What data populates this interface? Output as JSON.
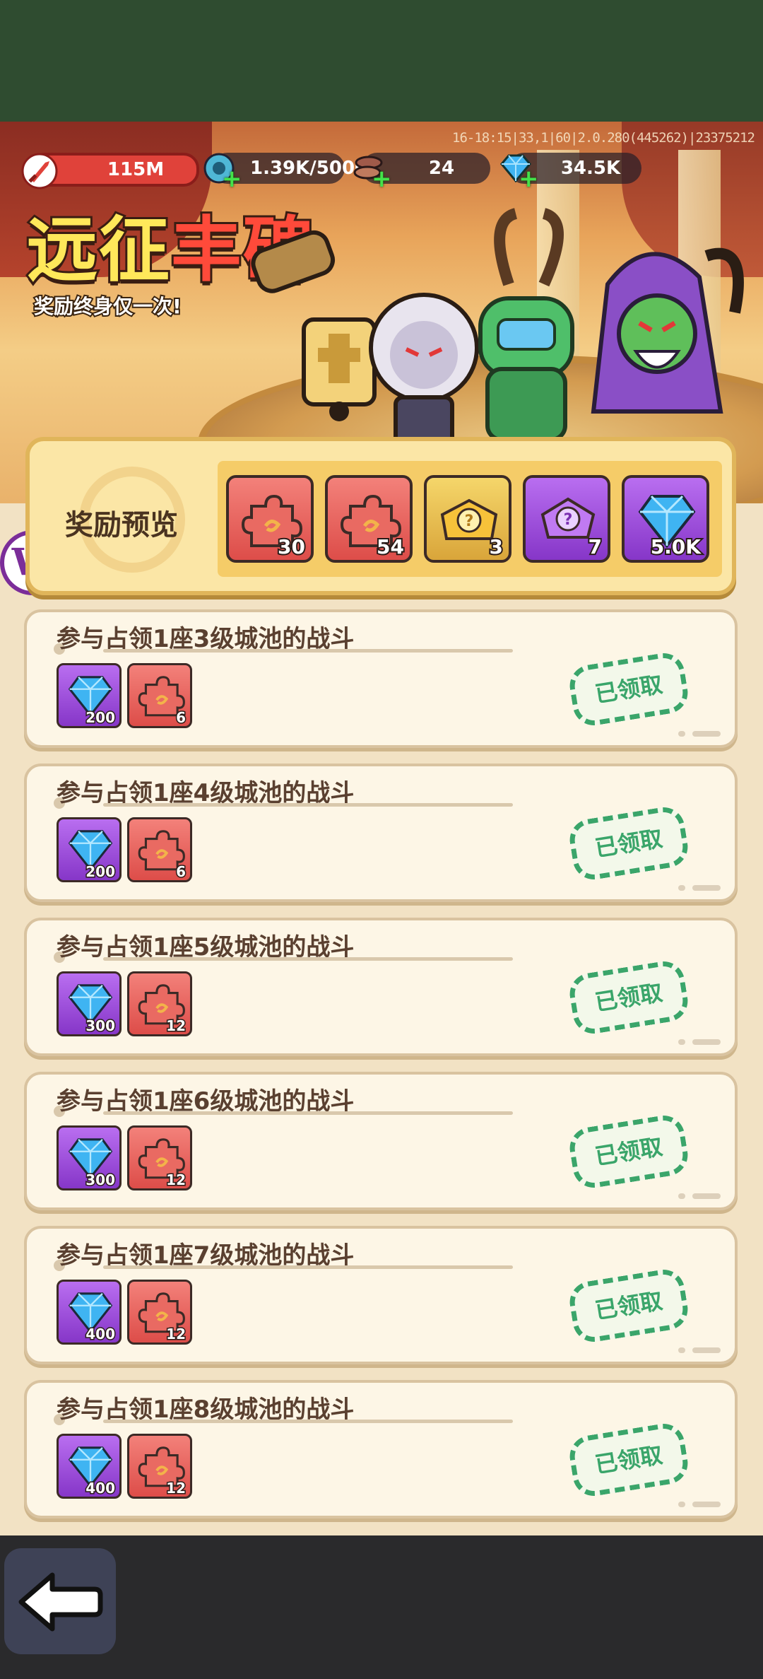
{
  "debug_info": "16-18:15|33,1|60|2.0.280(445262)|23375212",
  "resources": {
    "power": "115M",
    "energy": "1.39K/5000",
    "material": "24",
    "gems": "34.5K"
  },
  "banner": {
    "title_part1": "远征",
    "title_part2": "丰碑",
    "subtitle": "奖励终身仅一次!"
  },
  "preview": {
    "label": "奖励预览",
    "items": [
      {
        "icon": "puzzle-piece-icon",
        "count": "30",
        "color": "#e05650"
      },
      {
        "icon": "puzzle-piece-icon",
        "count": "54",
        "color": "#e05650"
      },
      {
        "icon": "mystery-chest-gold-icon",
        "count": "3",
        "color": "#e3b048"
      },
      {
        "icon": "mystery-gem-purple-icon",
        "count": "7",
        "color": "#9a45d6"
      },
      {
        "icon": "diamond-icon",
        "count": "5.0K",
        "color": "#9a45d6"
      }
    ]
  },
  "tasks": [
    {
      "title": "参与占领1座3级城池的战斗",
      "gems": "200",
      "pieces": "6",
      "status": "已领取"
    },
    {
      "title": "参与占领1座4级城池的战斗",
      "gems": "200",
      "pieces": "6",
      "status": "已领取"
    },
    {
      "title": "参与占领1座5级城池的战斗",
      "gems": "300",
      "pieces": "12",
      "status": "已领取"
    },
    {
      "title": "参与占领1座6级城池的战斗",
      "gems": "300",
      "pieces": "12",
      "status": "已领取"
    },
    {
      "title": "参与占领1座7级城池的战斗",
      "gems": "400",
      "pieces": "12",
      "status": "已领取"
    },
    {
      "title": "参与占领1座8级城池的战斗",
      "gems": "400",
      "pieces": "12",
      "status": "已领取"
    }
  ],
  "colors": {
    "claimed_stamp": "#3aa56a",
    "title_yellow": "#ffe85a",
    "title_red": "#ff4a3a"
  }
}
